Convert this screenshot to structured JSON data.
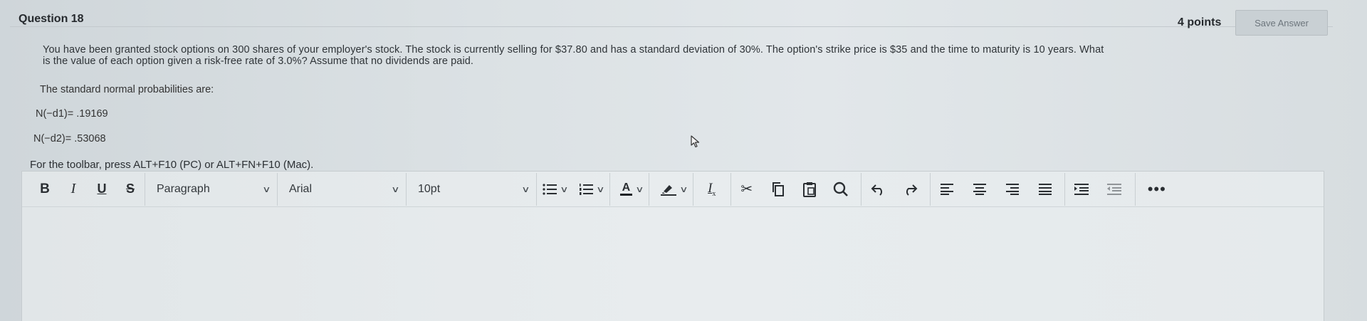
{
  "question": {
    "title": "Question 18",
    "points": "4 points",
    "save_label": "Save Answer",
    "text_line1": "You have been granted stock options on 300 shares of your employer's stock. The stock is currently selling for $37.80 and has a standard deviation of 30%. The option's strike price is $35 and the time to maturity is 10 years. What",
    "text_line2": "is the value of each option given a risk-free rate of 3.0%? Assume that no dividends are paid.",
    "prob_intro": "The standard normal probabilities are:",
    "nd1": "N(−d1)= .19169",
    "nd2": "N(−d2)= .53068",
    "toolbar_hint": "For the toolbar, press ALT+F10 (PC) or ALT+FN+F10 (Mac)."
  },
  "toolbar": {
    "bold": "B",
    "italic": "I",
    "underline": "U",
    "strike": "S",
    "paragraph": "Paragraph",
    "font": "Arial",
    "size": "10pt",
    "text_color_label": "A",
    "more": "•••"
  },
  "icons": [
    "bold-icon",
    "italic-icon",
    "underline-icon",
    "strikethrough-icon",
    "bullet-list-icon",
    "numbered-list-icon",
    "text-color-icon",
    "highlight-icon",
    "clear-format-icon",
    "cut-icon",
    "copy-icon",
    "paste-icon",
    "search-icon",
    "undo-icon",
    "redo-icon",
    "align-left-icon",
    "align-center-icon",
    "align-right-icon",
    "justify-icon",
    "indent-icon",
    "outdent-icon",
    "more-icon"
  ]
}
